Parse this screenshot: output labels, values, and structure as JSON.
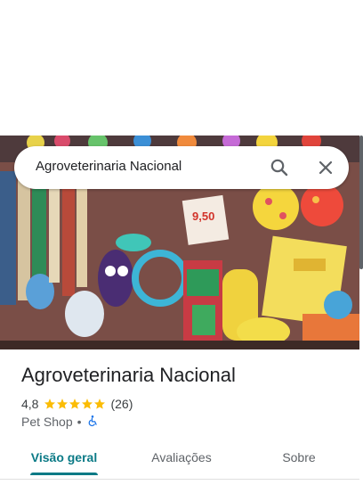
{
  "place": {
    "name": "Agroveterinaria Nacional",
    "rating": "4,8",
    "reviews": "(26)",
    "category": "Pet Shop",
    "separator": "•"
  },
  "search": {
    "value": "Agroveterinaria Nacional",
    "search_icon": "search-icon",
    "close_icon": "close-icon"
  },
  "hero": {
    "sign_price": "9,50"
  },
  "accessibility_icon": "wheelchair-icon",
  "tabs": [
    {
      "label": "Visão geral",
      "active": true
    },
    {
      "label": "Avaliações",
      "active": false
    },
    {
      "label": "Sobre",
      "active": false
    }
  ],
  "colors": {
    "accent": "#0b7a86",
    "star": "#fbbc04",
    "accessibility": "#1a73e8"
  }
}
